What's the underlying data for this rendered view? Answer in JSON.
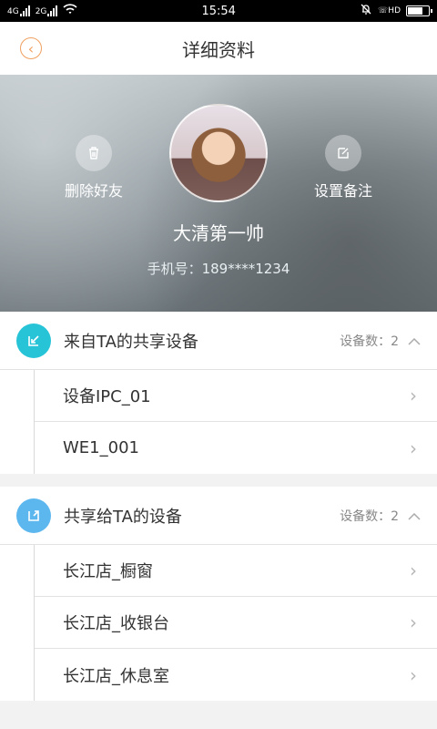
{
  "status_bar": {
    "time": "15:54",
    "signal1": "4G",
    "signal2": "2G",
    "hd": "HD"
  },
  "header": {
    "title": "详细资料"
  },
  "hero": {
    "delete_friend": "删除好友",
    "set_remark": "设置备注",
    "user_name": "大清第一帅",
    "phone_label": "手机号：",
    "phone": "189****1234"
  },
  "sections": [
    {
      "title": "来自TA的共享设备",
      "count_label": "设备数：",
      "count": "2",
      "color": "#27c4d7",
      "items": [
        {
          "label": "设备IPC_01"
        },
        {
          "label": "WE1_001"
        }
      ]
    },
    {
      "title": "共享给TA的设备",
      "count_label": "设备数：",
      "count": "2",
      "color": "#5db7ef",
      "items": [
        {
          "label": "长江店_橱窗"
        },
        {
          "label": "长江店_收银台"
        },
        {
          "label": "长江店_休息室"
        }
      ]
    }
  ]
}
